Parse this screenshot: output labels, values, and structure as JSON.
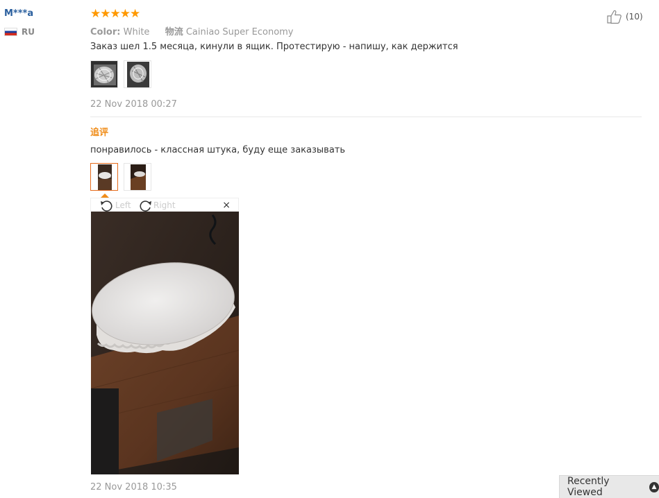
{
  "reviewer": {
    "name": "M***a",
    "country": "RU"
  },
  "review": {
    "rating_stars": "★★★★★",
    "rating": 5,
    "attributes": [
      {
        "key": "Color:",
        "value": "White"
      },
      {
        "key": "物流",
        "value": "Cainiao Super Economy"
      }
    ],
    "helpful_count": "(10)",
    "text": "Заказ шел 1.5 месяца, кинули в ящик. Протестирую - напишу, как держится",
    "date": "22 Nov 2018 00:27"
  },
  "followup": {
    "label": "追评",
    "text": "понравилось - классная штука, буду еще заказывать",
    "date": "22 Nov 2018 10:35"
  },
  "viewer": {
    "rotate_left": "Left",
    "rotate_right": "Right",
    "close": "×"
  },
  "recently_viewed": "Recently Viewed",
  "colors": {
    "accent": "#f08d1a",
    "star": "#ff9900",
    "link": "#2a5f9e"
  }
}
